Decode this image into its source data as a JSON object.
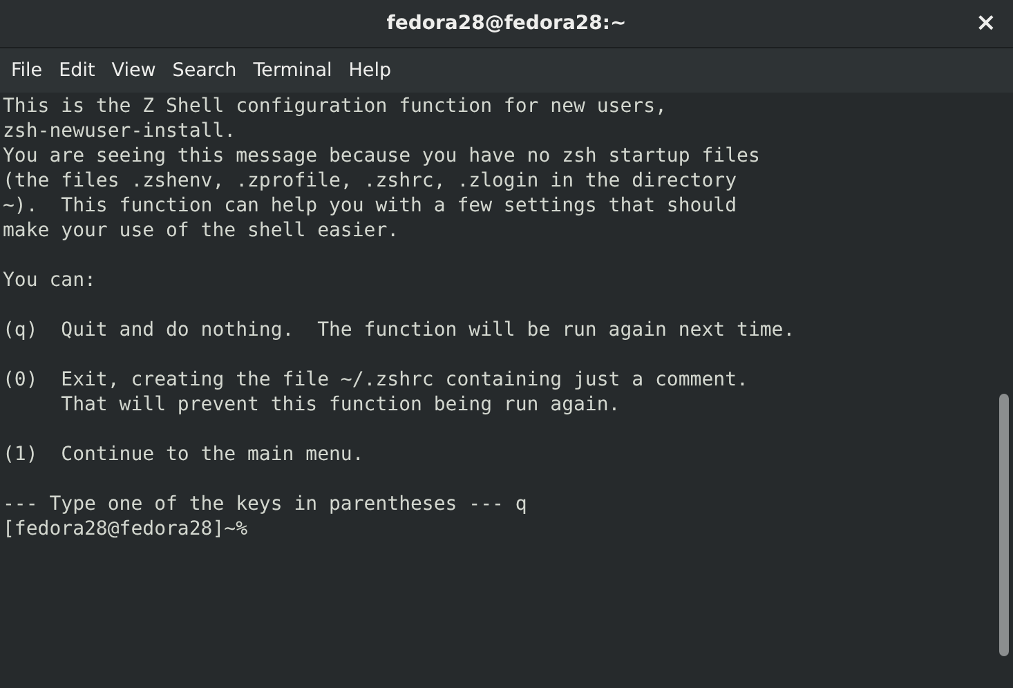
{
  "window": {
    "title": "fedora28@fedora28:~",
    "close": "×"
  },
  "menu": [
    {
      "label": "File"
    },
    {
      "label": "Edit"
    },
    {
      "label": "View"
    },
    {
      "label": "Search"
    },
    {
      "label": "Terminal"
    },
    {
      "label": "Help"
    }
  ],
  "terminal": {
    "paragraphs": [
      [
        "This is the Z Shell configuration function for new users,",
        "zsh-newuser-install.",
        "You are seeing this message because you have no zsh startup files",
        "(the files .zshenv, .zprofile, .zshrc, .zlogin in the directory",
        "~).  This function can help you with a few settings that should",
        "make your use of the shell easier."
      ],
      [
        "You can:"
      ],
      [
        "(q)  Quit and do nothing.  The function will be run again next time."
      ],
      [
        "(0)  Exit, creating the file ~/.zshrc containing just a comment.",
        "     That will prevent this function being run again."
      ],
      [
        "(1)  Continue to the main menu."
      ],
      [
        "--- Type one of the keys in parentheses --- q",
        "[fedora28@fedora28]~%"
      ]
    ]
  }
}
